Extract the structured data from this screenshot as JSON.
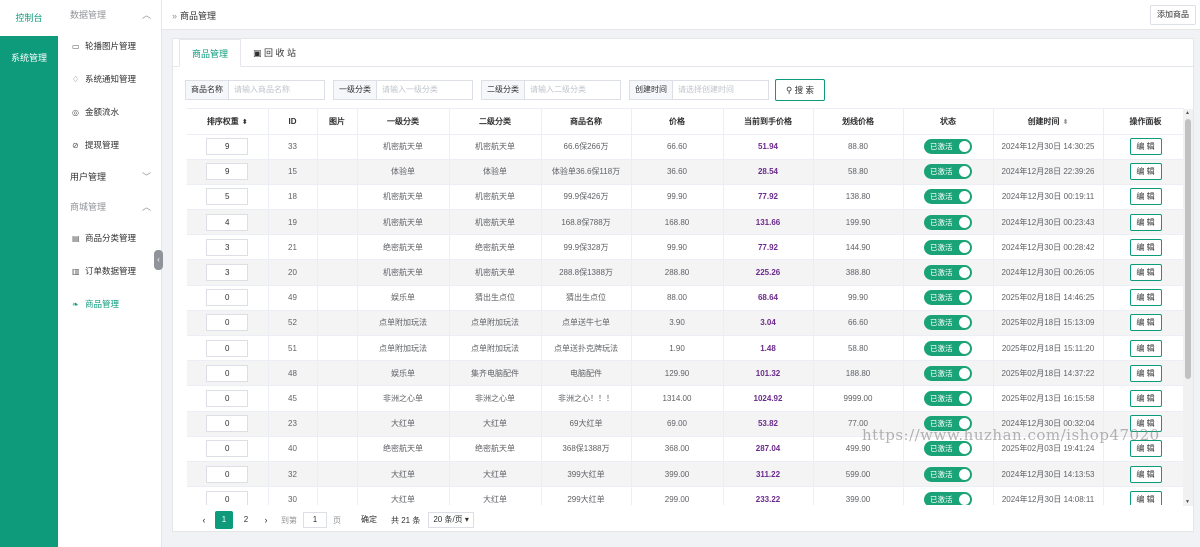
{
  "rail": {
    "dashboard": "控制台",
    "system": "系统管理"
  },
  "submenu": {
    "data_group": "数据管理",
    "data_items": [
      "轮播图片管理",
      "系统通知管理",
      "金额流水",
      "提现管理"
    ],
    "user_group": "用户管理",
    "shop_group": "商城管理",
    "shop_items": [
      "商品分类管理",
      "订单数据管理",
      "商品管理"
    ]
  },
  "header": {
    "breadcrumb": "商品管理",
    "add_button": "添加商品"
  },
  "tabs": [
    "商品管理",
    "回 收 站"
  ],
  "filters": [
    {
      "label": "商品名称",
      "placeholder": "请输入商品名称"
    },
    {
      "label": "一级分类",
      "placeholder": "请输入一级分类"
    },
    {
      "label": "二级分类",
      "placeholder": "请输入二级分类"
    },
    {
      "label": "创建时间",
      "placeholder": "请选择创建时间"
    }
  ],
  "search_button": "搜 索",
  "columns": [
    "排序权重",
    "ID",
    "图片",
    "一级分类",
    "二级分类",
    "商品名称",
    "价格",
    "当前到手价格",
    "划线价格",
    "状态",
    "创建时间",
    "操作面板"
  ],
  "status_label": "已激活",
  "edit_label": "编 辑",
  "rows": [
    {
      "weight": "9",
      "id": "33",
      "cat1": "机密航天单",
      "cat2": "机密航天单",
      "name": "66.6保266万",
      "price": "66.60",
      "current": "51.94",
      "strike": "88.80",
      "created": "2024年12月30日 14:30:25"
    },
    {
      "weight": "9",
      "id": "15",
      "cat1": "体验单",
      "cat2": "体验单",
      "name": "体验单36.6保118万",
      "price": "36.60",
      "current": "28.54",
      "strike": "58.80",
      "created": "2024年12月28日 22:39:26"
    },
    {
      "weight": "5",
      "id": "18",
      "cat1": "机密航天单",
      "cat2": "机密航天单",
      "name": "99.9保426万",
      "price": "99.90",
      "current": "77.92",
      "strike": "138.80",
      "created": "2024年12月30日 00:19:11"
    },
    {
      "weight": "4",
      "id": "19",
      "cat1": "机密航天单",
      "cat2": "机密航天单",
      "name": "168.8保788万",
      "price": "168.80",
      "current": "131.66",
      "strike": "199.90",
      "created": "2024年12月30日 00:23:43"
    },
    {
      "weight": "3",
      "id": "21",
      "cat1": "绝密航天单",
      "cat2": "绝密航天单",
      "name": "99.9保328万",
      "price": "99.90",
      "current": "77.92",
      "strike": "144.90",
      "created": "2024年12月30日 00:28:42"
    },
    {
      "weight": "3",
      "id": "20",
      "cat1": "机密航天单",
      "cat2": "机密航天单",
      "name": "288.8保1388万",
      "price": "288.80",
      "current": "225.26",
      "strike": "388.80",
      "created": "2024年12月30日 00:26:05"
    },
    {
      "weight": "0",
      "id": "49",
      "cat1": "娱乐单",
      "cat2": "猜出生点位",
      "name": "猜出生点位",
      "price": "88.00",
      "current": "68.64",
      "strike": "99.90",
      "created": "2025年02月18日 14:46:25"
    },
    {
      "weight": "0",
      "id": "52",
      "cat1": "点单附加玩法",
      "cat2": "点单附加玩法",
      "name": "点单送牛七单",
      "price": "3.90",
      "current": "3.04",
      "strike": "66.60",
      "created": "2025年02月18日 15:13:09"
    },
    {
      "weight": "0",
      "id": "51",
      "cat1": "点单附加玩法",
      "cat2": "点单附加玩法",
      "name": "点单送扑克牌玩法",
      "price": "1.90",
      "current": "1.48",
      "strike": "58.80",
      "created": "2025年02月18日 15:11:20"
    },
    {
      "weight": "0",
      "id": "48",
      "cat1": "娱乐单",
      "cat2": "集齐电脑配件",
      "name": "电脑配件",
      "price": "129.90",
      "current": "101.32",
      "strike": "188.80",
      "created": "2025年02月18日 14:37:22"
    },
    {
      "weight": "0",
      "id": "45",
      "cat1": "非洲之心单",
      "cat2": "非洲之心单",
      "name": "非洲之心！！！",
      "price": "1314.00",
      "current": "1024.92",
      "strike": "9999.00",
      "created": "2025年02月13日 16:15:58"
    },
    {
      "weight": "0",
      "id": "23",
      "cat1": "大红单",
      "cat2": "大红单",
      "name": "69大红单",
      "price": "69.00",
      "current": "53.82",
      "strike": "77.00",
      "created": "2024年12月30日 00:32:04"
    },
    {
      "weight": "0",
      "id": "40",
      "cat1": "绝密航天单",
      "cat2": "绝密航天单",
      "name": "368保1388万",
      "price": "368.00",
      "current": "287.04",
      "strike": "499.90",
      "created": "2025年02月03日 19:41:24"
    },
    {
      "weight": "0",
      "id": "32",
      "cat1": "大红单",
      "cat2": "大红单",
      "name": "399大红单",
      "price": "399.00",
      "current": "311.22",
      "strike": "599.00",
      "created": "2024年12月30日 14:13:53"
    },
    {
      "weight": "0",
      "id": "30",
      "cat1": "大红单",
      "cat2": "大红单",
      "name": "299大红单",
      "price": "299.00",
      "current": "233.22",
      "strike": "399.00",
      "created": "2024年12月30日 14:08:11"
    }
  ],
  "pagination": {
    "pages": [
      "1",
      "2"
    ],
    "goto_label": "到第",
    "goto_value": "1",
    "page_unit": "页",
    "confirm": "确定",
    "total": "共 21 条",
    "page_size": "20 条/页"
  },
  "watermark": "https://www.huzhan.com/ishop47020",
  "colors": {
    "brand": "#0d9b7c",
    "current_price": "#6b2a8c"
  }
}
